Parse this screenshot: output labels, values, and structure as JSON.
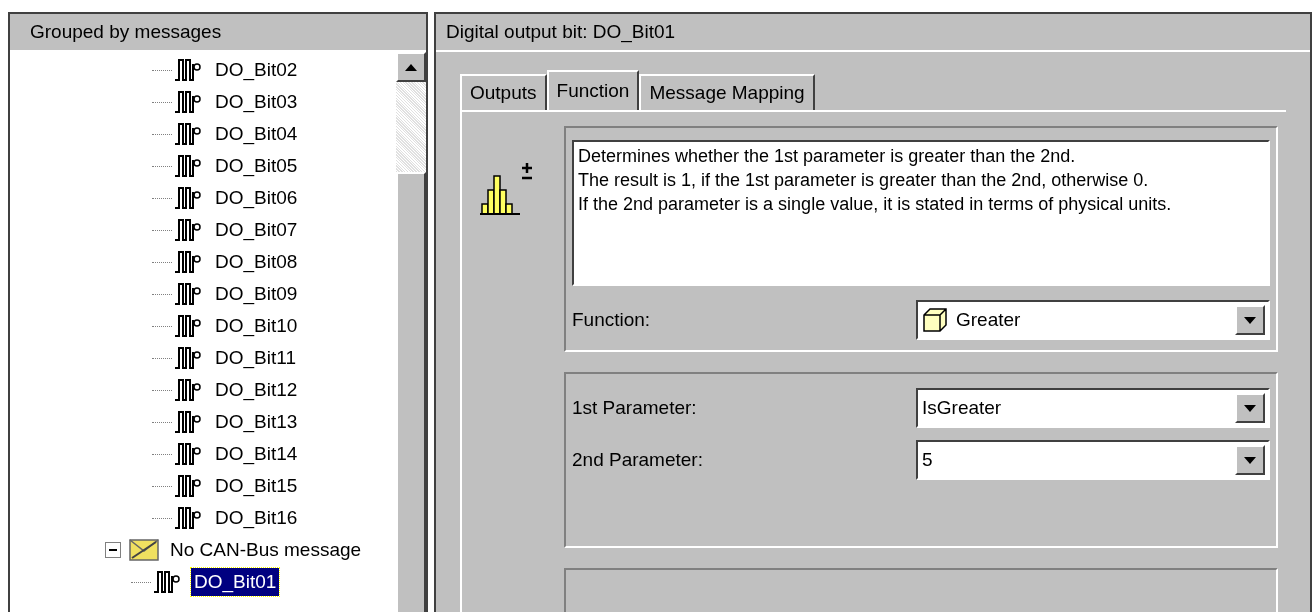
{
  "tree_panel": {
    "title": "Grouped by messages",
    "items": [
      {
        "label": "DO_Bit02",
        "kind": "bit",
        "selected": false
      },
      {
        "label": "DO_Bit03",
        "kind": "bit",
        "selected": false
      },
      {
        "label": "DO_Bit04",
        "kind": "bit",
        "selected": false
      },
      {
        "label": "DO_Bit05",
        "kind": "bit",
        "selected": false
      },
      {
        "label": "DO_Bit06",
        "kind": "bit",
        "selected": false
      },
      {
        "label": "DO_Bit07",
        "kind": "bit",
        "selected": false
      },
      {
        "label": "DO_Bit08",
        "kind": "bit",
        "selected": false
      },
      {
        "label": "DO_Bit09",
        "kind": "bit",
        "selected": false
      },
      {
        "label": "DO_Bit10",
        "kind": "bit",
        "selected": false
      },
      {
        "label": "DO_Bit11",
        "kind": "bit",
        "selected": false
      },
      {
        "label": "DO_Bit12",
        "kind": "bit",
        "selected": false
      },
      {
        "label": "DO_Bit13",
        "kind": "bit",
        "selected": false
      },
      {
        "label": "DO_Bit14",
        "kind": "bit",
        "selected": false
      },
      {
        "label": "DO_Bit15",
        "kind": "bit",
        "selected": false
      },
      {
        "label": "DO_Bit16",
        "kind": "bit",
        "selected": false
      },
      {
        "label": "No CAN-Bus message",
        "kind": "message",
        "selected": false,
        "expanded": true,
        "children": [
          {
            "label": "DO_Bit01",
            "kind": "bit",
            "selected": true
          }
        ]
      }
    ]
  },
  "detail_panel": {
    "title": "Digital output bit: DO_Bit01",
    "tabs": [
      {
        "label": "Outputs",
        "selected": false
      },
      {
        "label": "Function",
        "selected": true
      },
      {
        "label": "Message Mapping",
        "selected": false
      }
    ],
    "description": "Determines whether the 1st parameter is greater than the 2nd.\nThe result is 1, if the 1st parameter is greater than the 2nd, otherwise 0.\nIf the 2nd parameter is a single value, it is stated in terms of physical units.",
    "function": {
      "label": "Function:",
      "value": "Greater"
    },
    "parameters": [
      {
        "label": "1st Parameter:",
        "value": "IsGreater"
      },
      {
        "label": "2nd Parameter:",
        "value": "5"
      }
    ]
  }
}
